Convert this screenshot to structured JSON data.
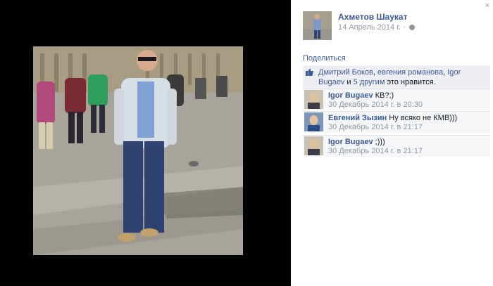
{
  "post": {
    "author": "Ахметов Шаукат",
    "date": "14 Апрель 2014 г.",
    "separator": "·",
    "share": "Поделиться",
    "close": "×"
  },
  "likes": {
    "user1": "Дмитрий Боков",
    "sep1": ", ",
    "user2": "евгения романова",
    "sep2": ", ",
    "user3": "Igor Bugaev",
    "conj": " и ",
    "others": "5 другим",
    "suffix": " это нравится."
  },
  "comments": [
    {
      "author": "Igor Bugaev",
      "text": " КВ?;)",
      "time": "30 Декабрь 2014 г. в 20:30"
    },
    {
      "author": "Евгений Зызин",
      "text": " Ну всяко не КМВ)))",
      "time": "30 Декабрь 2014 г. в 21:17"
    },
    {
      "author": "Igor Bugaev",
      "text": " ;)))",
      "time": "30 Декабрь 2014 г. в 21:17"
    }
  ],
  "colors": {
    "link": "#3b5998",
    "muted": "#9197a3",
    "panel": "#edeff4",
    "comment_bg": "#f6f7f9",
    "stage": "#000000"
  },
  "icons": [
    "close-icon",
    "globe-icon",
    "like-thumb-icon"
  ]
}
